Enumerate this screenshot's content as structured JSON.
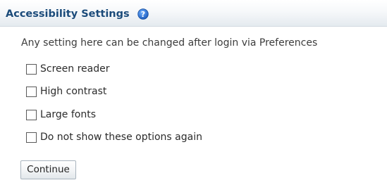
{
  "header": {
    "title": "Accessibility Settings",
    "help_icon": "question-circle-icon"
  },
  "description": "Any setting here can be changed after login via Preferences",
  "options": [
    {
      "label": "Screen reader",
      "checked": false
    },
    {
      "label": "High contrast",
      "checked": false
    },
    {
      "label": "Large fonts",
      "checked": false
    },
    {
      "label": "Do not show these options again",
      "checked": false
    }
  ],
  "continue_label": "Continue",
  "colors": {
    "title": "#1b4b7a",
    "help_icon": "#1f6fd0"
  }
}
